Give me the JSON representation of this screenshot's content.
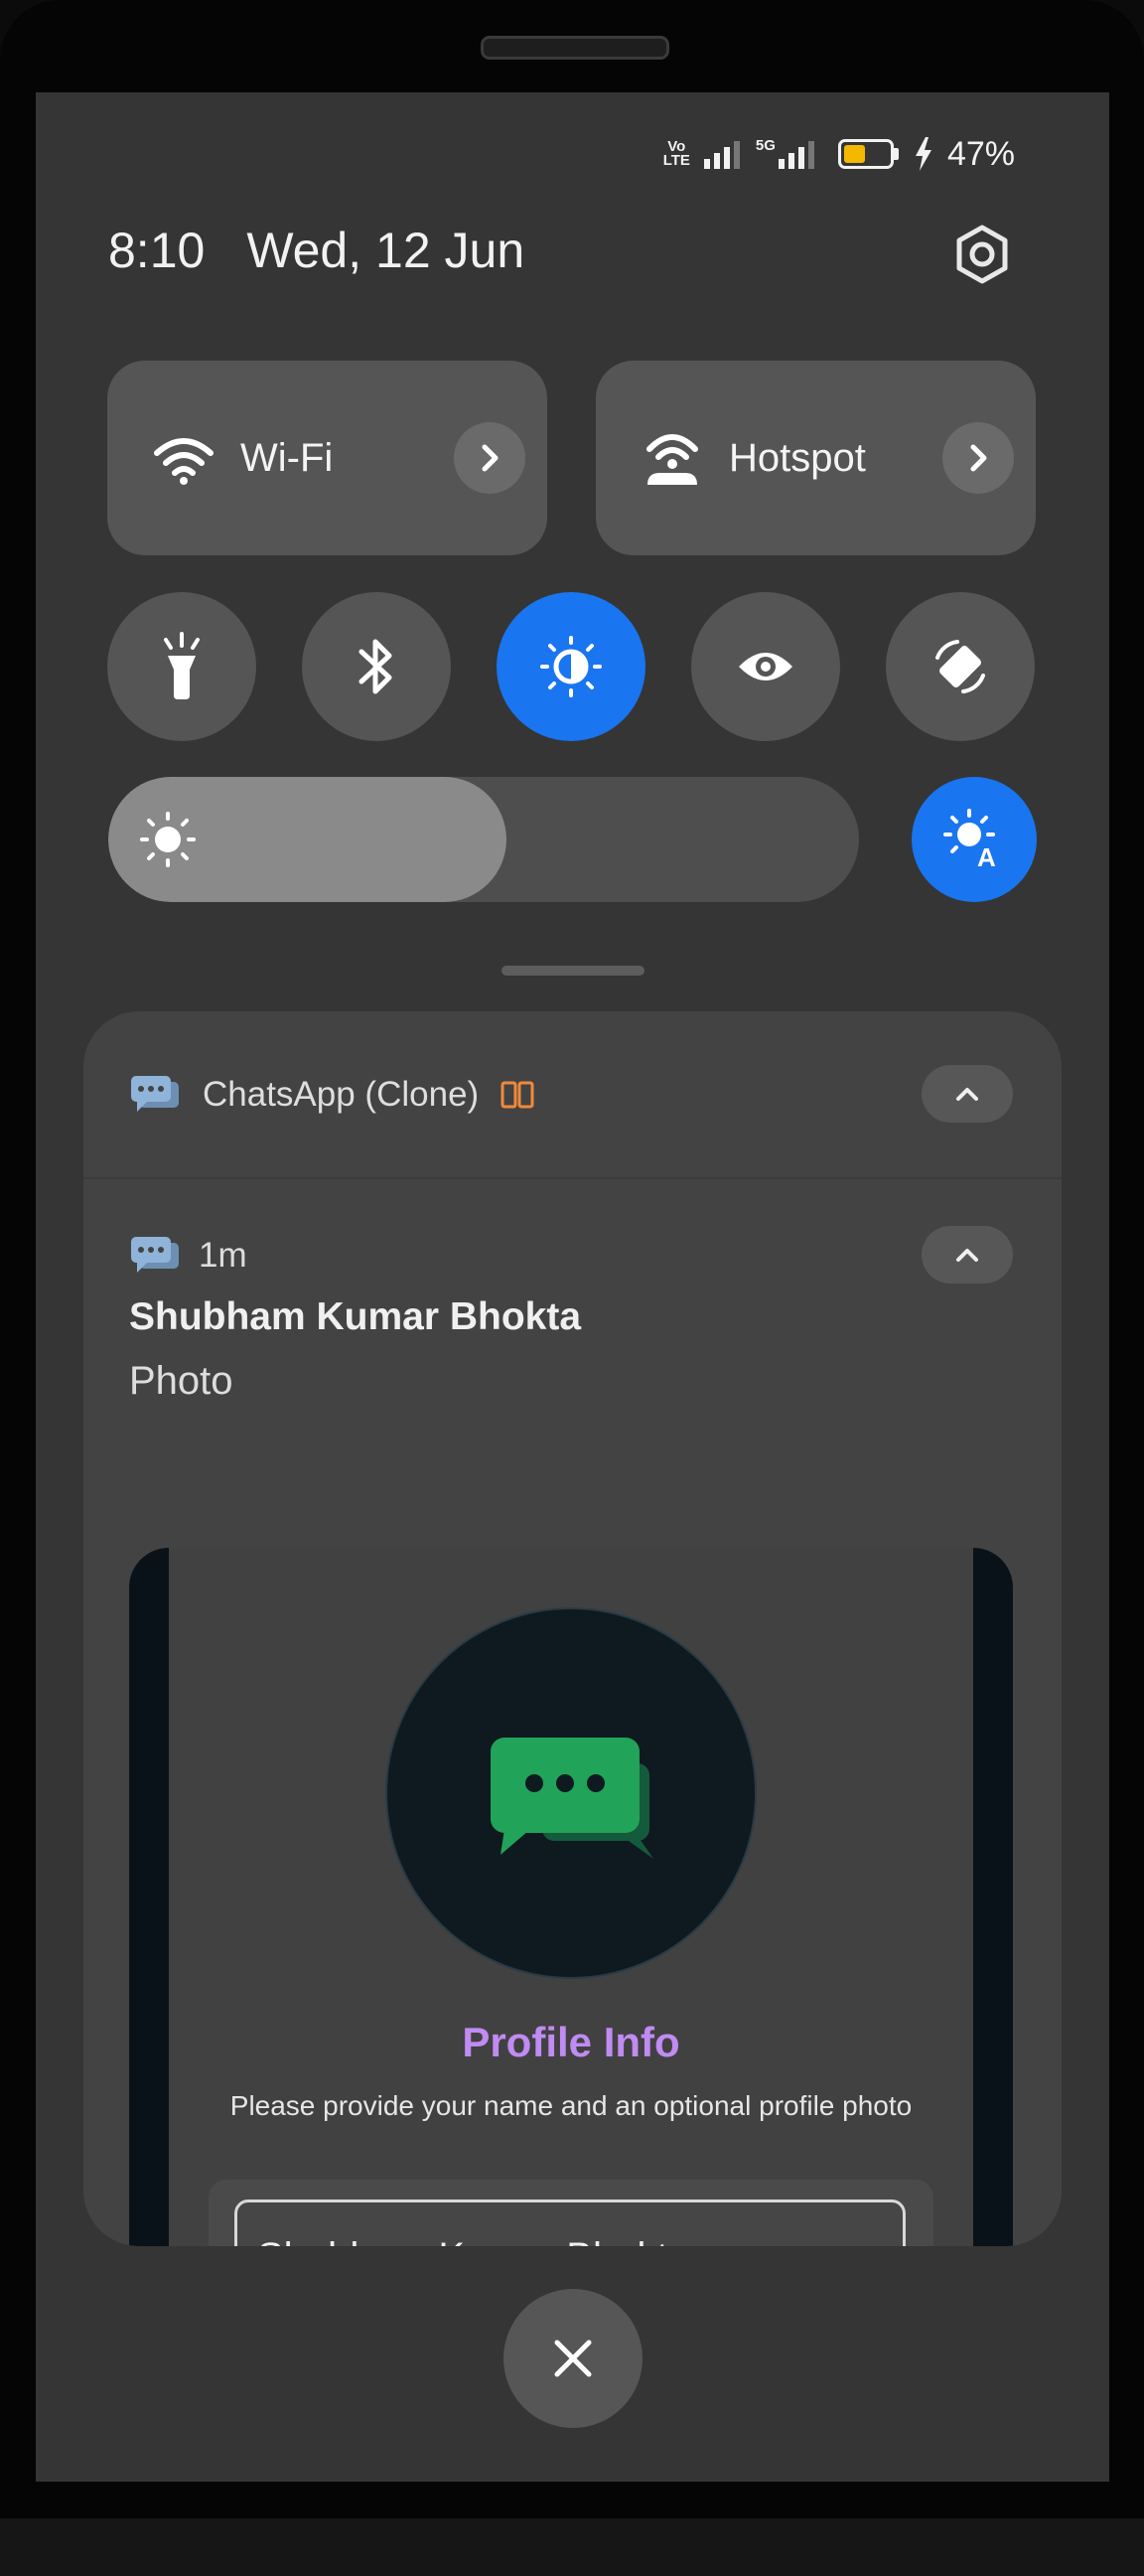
{
  "status_bar": {
    "volte_label_top": "Vo",
    "volte_label_bottom": "LTE",
    "network_label": "5G",
    "battery_percent": "47%",
    "battery_level": 0.47,
    "charging": true
  },
  "header": {
    "time": "8:10",
    "date": "Wed, 12 Jun"
  },
  "tiles": [
    {
      "label": "Wi-Fi",
      "icon": "wifi-icon"
    },
    {
      "label": "Hotspot",
      "icon": "hotspot-icon"
    }
  ],
  "quick_toggles": [
    {
      "icon": "flashlight-icon",
      "active": false
    },
    {
      "icon": "bluetooth-icon",
      "active": false
    },
    {
      "icon": "dark-mode-icon",
      "active": true
    },
    {
      "icon": "eye-comfort-icon",
      "active": false
    },
    {
      "icon": "auto-rotate-icon",
      "active": false
    }
  ],
  "brightness": {
    "level": 0.53,
    "auto_label": "A"
  },
  "notification": {
    "app_name": "ChatsApp (Clone)",
    "age": "1m",
    "sender": "Shubham Kumar Bhokta",
    "message": "Photo",
    "preview": {
      "title": "Profile Info",
      "subtitle": "Please provide your name and an optional profile photo",
      "name_value": "Shubham Kumar Bhokta"
    }
  },
  "colors": {
    "accent": "#1a75f0",
    "profile_title": "#c08bf2",
    "app_icon": "#8fb3d9",
    "chat_green": "#21a35a"
  }
}
